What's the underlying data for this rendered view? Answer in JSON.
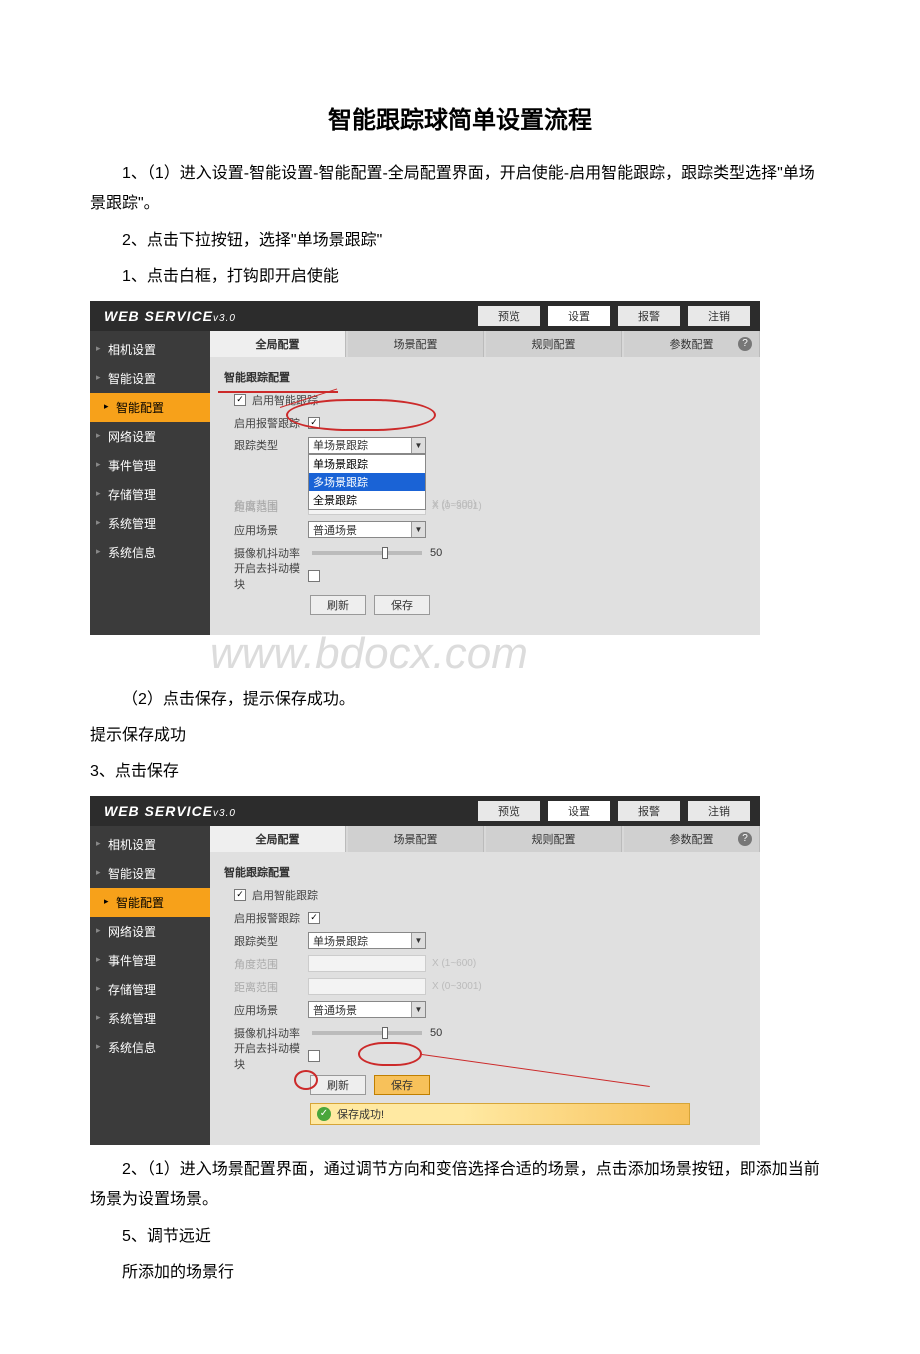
{
  "doc": {
    "title": "智能跟踪球简单设置流程",
    "p1": "1、（1）进入设置-智能设置-智能配置-全局配置界面，开启使能-启用智能跟踪，跟踪类型选择\"单场景跟踪\"。",
    "p2": "2、点击下拉按钮，选择\"单场景跟踪\"",
    "p3": "1、点击白框，打钩即开启使能",
    "p4": "（2）点击保存，提示保存成功。",
    "p5": "提示保存成功",
    "p6": "3、点击保存",
    "p7": "2、（1）进入场景配置界面，通过调节方向和变倍选择合适的场景，点击添加场景按钮，即添加当前场景为设置场景。",
    "p8": "5、调节远近",
    "p9": "所添加的场景行",
    "watermark": "www.bdocx.com"
  },
  "ui": {
    "brand": "WEB  SERVICE",
    "version": "v3.0",
    "top": {
      "preview": "预览",
      "settings": "设置",
      "alarm": "报警",
      "logout": "注销"
    },
    "side": {
      "camera": "相机设置",
      "smart": "智能设置",
      "smart_cfg": "智能配置",
      "network": "网络设置",
      "event": "事件管理",
      "storage": "存储管理",
      "system": "系统管理",
      "info": "系统信息"
    },
    "tabs": {
      "global": "全局配置",
      "scene": "场景配置",
      "rule": "规则配置",
      "param": "参数配置"
    },
    "help": "?",
    "form": {
      "section": "智能跟踪配置",
      "enable_smart": "启用智能跟踪",
      "enable_alarm": "启用报警跟踪",
      "track_type": "跟踪类型",
      "track_sel": "单场景跟踪",
      "opts": {
        "single": "单场景跟踪",
        "multi": "多场景跟踪",
        "pano": "全景跟踪"
      },
      "jiaodu": "角度范围",
      "jiaodu_hint": "X (1~600)",
      "juli": "距离范围",
      "juli_hint": "X (0~3001)",
      "scene": "应用场景",
      "scene_sel": "普通场景",
      "jitter": "摄像机抖动率",
      "jitter_val": "50",
      "antishake": "开启去抖动模块",
      "refresh": "刷新",
      "save": "保存",
      "success": "保存成功!"
    }
  }
}
